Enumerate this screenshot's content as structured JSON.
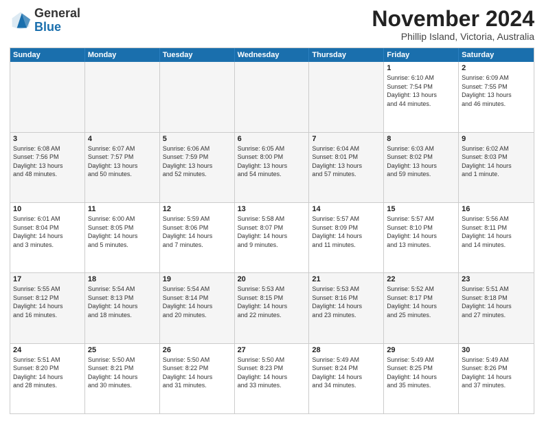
{
  "header": {
    "logo_general": "General",
    "logo_blue": "Blue",
    "month_title": "November 2024",
    "location": "Phillip Island, Victoria, Australia"
  },
  "weekdays": [
    "Sunday",
    "Monday",
    "Tuesday",
    "Wednesday",
    "Thursday",
    "Friday",
    "Saturday"
  ],
  "rows": [
    [
      {
        "day": "",
        "info": "",
        "empty": true
      },
      {
        "day": "",
        "info": "",
        "empty": true
      },
      {
        "day": "",
        "info": "",
        "empty": true
      },
      {
        "day": "",
        "info": "",
        "empty": true
      },
      {
        "day": "",
        "info": "",
        "empty": true
      },
      {
        "day": "1",
        "info": "Sunrise: 6:10 AM\nSunset: 7:54 PM\nDaylight: 13 hours\nand 44 minutes."
      },
      {
        "day": "2",
        "info": "Sunrise: 6:09 AM\nSunset: 7:55 PM\nDaylight: 13 hours\nand 46 minutes."
      }
    ],
    [
      {
        "day": "3",
        "info": "Sunrise: 6:08 AM\nSunset: 7:56 PM\nDaylight: 13 hours\nand 48 minutes."
      },
      {
        "day": "4",
        "info": "Sunrise: 6:07 AM\nSunset: 7:57 PM\nDaylight: 13 hours\nand 50 minutes."
      },
      {
        "day": "5",
        "info": "Sunrise: 6:06 AM\nSunset: 7:59 PM\nDaylight: 13 hours\nand 52 minutes."
      },
      {
        "day": "6",
        "info": "Sunrise: 6:05 AM\nSunset: 8:00 PM\nDaylight: 13 hours\nand 54 minutes."
      },
      {
        "day": "7",
        "info": "Sunrise: 6:04 AM\nSunset: 8:01 PM\nDaylight: 13 hours\nand 57 minutes."
      },
      {
        "day": "8",
        "info": "Sunrise: 6:03 AM\nSunset: 8:02 PM\nDaylight: 13 hours\nand 59 minutes."
      },
      {
        "day": "9",
        "info": "Sunrise: 6:02 AM\nSunset: 8:03 PM\nDaylight: 14 hours\nand 1 minute."
      }
    ],
    [
      {
        "day": "10",
        "info": "Sunrise: 6:01 AM\nSunset: 8:04 PM\nDaylight: 14 hours\nand 3 minutes."
      },
      {
        "day": "11",
        "info": "Sunrise: 6:00 AM\nSunset: 8:05 PM\nDaylight: 14 hours\nand 5 minutes."
      },
      {
        "day": "12",
        "info": "Sunrise: 5:59 AM\nSunset: 8:06 PM\nDaylight: 14 hours\nand 7 minutes."
      },
      {
        "day": "13",
        "info": "Sunrise: 5:58 AM\nSunset: 8:07 PM\nDaylight: 14 hours\nand 9 minutes."
      },
      {
        "day": "14",
        "info": "Sunrise: 5:57 AM\nSunset: 8:09 PM\nDaylight: 14 hours\nand 11 minutes."
      },
      {
        "day": "15",
        "info": "Sunrise: 5:57 AM\nSunset: 8:10 PM\nDaylight: 14 hours\nand 13 minutes."
      },
      {
        "day": "16",
        "info": "Sunrise: 5:56 AM\nSunset: 8:11 PM\nDaylight: 14 hours\nand 14 minutes."
      }
    ],
    [
      {
        "day": "17",
        "info": "Sunrise: 5:55 AM\nSunset: 8:12 PM\nDaylight: 14 hours\nand 16 minutes."
      },
      {
        "day": "18",
        "info": "Sunrise: 5:54 AM\nSunset: 8:13 PM\nDaylight: 14 hours\nand 18 minutes."
      },
      {
        "day": "19",
        "info": "Sunrise: 5:54 AM\nSunset: 8:14 PM\nDaylight: 14 hours\nand 20 minutes."
      },
      {
        "day": "20",
        "info": "Sunrise: 5:53 AM\nSunset: 8:15 PM\nDaylight: 14 hours\nand 22 minutes."
      },
      {
        "day": "21",
        "info": "Sunrise: 5:53 AM\nSunset: 8:16 PM\nDaylight: 14 hours\nand 23 minutes."
      },
      {
        "day": "22",
        "info": "Sunrise: 5:52 AM\nSunset: 8:17 PM\nDaylight: 14 hours\nand 25 minutes."
      },
      {
        "day": "23",
        "info": "Sunrise: 5:51 AM\nSunset: 8:18 PM\nDaylight: 14 hours\nand 27 minutes."
      }
    ],
    [
      {
        "day": "24",
        "info": "Sunrise: 5:51 AM\nSunset: 8:20 PM\nDaylight: 14 hours\nand 28 minutes."
      },
      {
        "day": "25",
        "info": "Sunrise: 5:50 AM\nSunset: 8:21 PM\nDaylight: 14 hours\nand 30 minutes."
      },
      {
        "day": "26",
        "info": "Sunrise: 5:50 AM\nSunset: 8:22 PM\nDaylight: 14 hours\nand 31 minutes."
      },
      {
        "day": "27",
        "info": "Sunrise: 5:50 AM\nSunset: 8:23 PM\nDaylight: 14 hours\nand 33 minutes."
      },
      {
        "day": "28",
        "info": "Sunrise: 5:49 AM\nSunset: 8:24 PM\nDaylight: 14 hours\nand 34 minutes."
      },
      {
        "day": "29",
        "info": "Sunrise: 5:49 AM\nSunset: 8:25 PM\nDaylight: 14 hours\nand 35 minutes."
      },
      {
        "day": "30",
        "info": "Sunrise: 5:49 AM\nSunset: 8:26 PM\nDaylight: 14 hours\nand 37 minutes."
      }
    ]
  ]
}
